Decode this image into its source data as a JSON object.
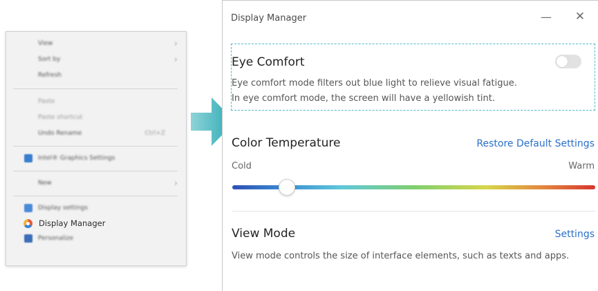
{
  "context_menu": {
    "items": [
      {
        "label": "View",
        "chevron": "›"
      },
      {
        "label": "Sort by",
        "chevron": "›"
      },
      {
        "label": "Refresh"
      },
      {
        "label": "Paste"
      },
      {
        "label": "Paste shortcut"
      },
      {
        "label": "Undo Rename",
        "shortcut": "Ctrl+Z"
      },
      {
        "label": "Intel® Graphics Settings"
      },
      {
        "label": "New",
        "chevron": "›"
      },
      {
        "label": "Display settings"
      },
      {
        "label": "Display Manager"
      },
      {
        "label": "Personalize"
      }
    ]
  },
  "display_manager": {
    "title": "Display Manager",
    "minimize": "—",
    "close": "✕",
    "eye_comfort": {
      "title": "Eye Comfort",
      "line1": "Eye comfort mode filters out blue light to relieve visual fatigue.",
      "line2": "In eye comfort mode, the screen will have a yellowish tint.",
      "enabled": false
    },
    "color_temperature": {
      "title": "Color Temperature",
      "restore_link": "Restore Default Settings",
      "cold_label": "Cold",
      "warm_label": "Warm",
      "slider_value": 0.15
    },
    "view_mode": {
      "title": "View Mode",
      "settings_link": "Settings",
      "description": "View mode controls the size of interface elements, such as texts and apps."
    }
  },
  "colors": {
    "accent_link": "#2a6fc9",
    "dashed_highlight": "#4fb8d4",
    "arrow": "#3ab3b8"
  }
}
